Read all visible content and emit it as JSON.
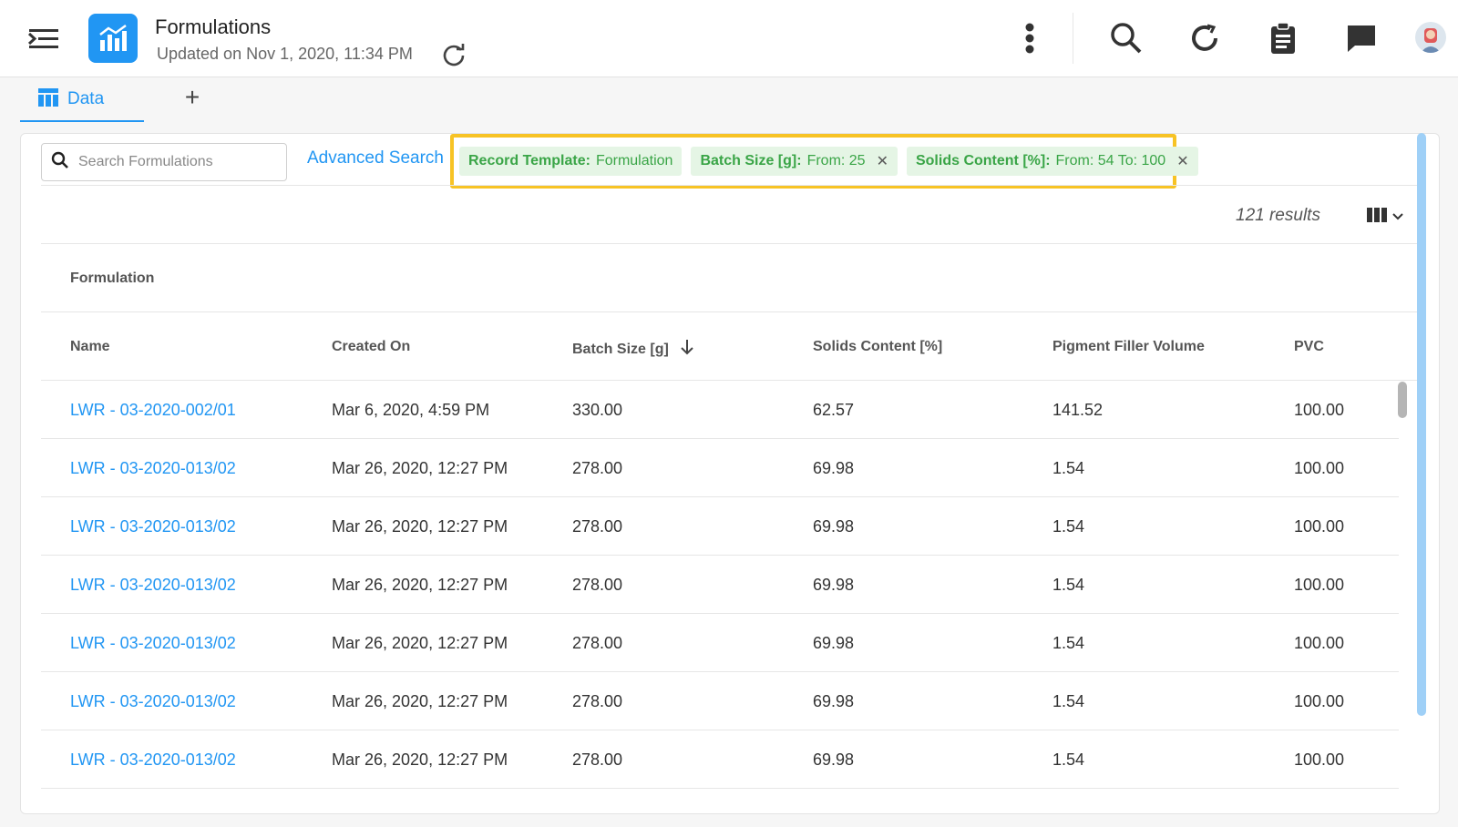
{
  "header": {
    "title": "Formulations",
    "subtitle": "Updated on Nov 1, 2020, 11:34 PM"
  },
  "tabs": [
    {
      "label": "Data"
    }
  ],
  "search": {
    "placeholder": "Search Formulations",
    "advanced_label": "Advanced Search"
  },
  "filters": [
    {
      "key": "Record Template:",
      "value": " Formulation",
      "removable": false
    },
    {
      "key": "Batch Size [g]:",
      "value": " From: 25",
      "removable": true
    },
    {
      "key": "Solids Content [%]:",
      "value": " From: 54 To: 100",
      "removable": true
    }
  ],
  "results_text": "121 results",
  "group_header": "Formulation",
  "columns": [
    "Name",
    "Created On",
    "Batch Size [g]",
    "Solids Content [%]",
    "Pigment Filler Volume",
    "PVC"
  ],
  "rows": [
    [
      "LWR - 03-2020-002/01",
      "Mar 6, 2020, 4:59 PM",
      "330.00",
      "62.57",
      "141.52",
      "100.00"
    ],
    [
      "LWR - 03-2020-013/02",
      "Mar 26, 2020, 12:27 PM",
      "278.00",
      "69.98",
      "1.54",
      "100.00"
    ],
    [
      "LWR - 03-2020-013/02",
      "Mar 26, 2020, 12:27 PM",
      "278.00",
      "69.98",
      "1.54",
      "100.00"
    ],
    [
      "LWR - 03-2020-013/02",
      "Mar 26, 2020, 12:27 PM",
      "278.00",
      "69.98",
      "1.54",
      "100.00"
    ],
    [
      "LWR - 03-2020-013/02",
      "Mar 26, 2020, 12:27 PM",
      "278.00",
      "69.98",
      "1.54",
      "100.00"
    ],
    [
      "LWR - 03-2020-013/02",
      "Mar 26, 2020, 12:27 PM",
      "278.00",
      "69.98",
      "1.54",
      "100.00"
    ],
    [
      "LWR - 03-2020-013/02",
      "Mar 26, 2020, 12:27 PM",
      "278.00",
      "69.98",
      "1.54",
      "100.00"
    ]
  ],
  "colors": {
    "accent": "#2196f3",
    "chip_bg": "#e5f5e5",
    "chip_text": "#3aa547",
    "highlight": "#f7c325"
  },
  "icons": [
    "menu-icon",
    "chart-icon",
    "refresh-icon",
    "more-vert-icon",
    "search-icon",
    "sync-icon",
    "clipboard-icon",
    "chat-icon",
    "avatar",
    "table-icon",
    "plus-icon",
    "close-icon",
    "columns-icon",
    "chevron-down-icon",
    "arrow-down-icon"
  ]
}
